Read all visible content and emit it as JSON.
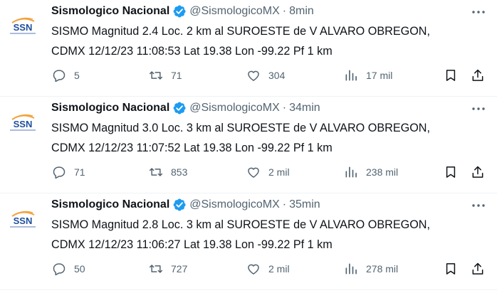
{
  "colors": {
    "text": "#0f1419",
    "muted": "#536471",
    "verified": "#1d9bf0",
    "logo_blue": "#1f4e9c",
    "logo_orange": "#f2a341"
  },
  "icons": {
    "reply": "speech-bubble-icon",
    "retweet": "retweet-arrows-icon",
    "like": "heart-icon",
    "views": "bar-chart-icon",
    "bookmark": "bookmark-icon",
    "share": "share-upload-icon",
    "more": "more-dots-icon",
    "verified": "verified-badge-icon"
  },
  "tweets": [
    {
      "avatar_text": "SSN",
      "name": "Sismologico Nacional",
      "handle": "@SismologicoMX",
      "separator": "·",
      "time": "8min",
      "line1": "SISMO Magnitud 2.4 Loc. 2 km al SUROESTE de V ALVARO OBREGON,",
      "line2": "CDMX 12/12/23 11:08:53 Lat 19.38 Lon -99.22 Pf 1 km",
      "replies": "5",
      "retweets": "71",
      "likes": "304",
      "views": "17 mil"
    },
    {
      "avatar_text": "SSN",
      "name": "Sismologico Nacional",
      "handle": "@SismologicoMX",
      "separator": "·",
      "time": "34min",
      "line1": "SISMO Magnitud 3.0 Loc. 3 km al SUROESTE de V ALVARO OBREGON,",
      "line2": "CDMX 12/12/23 11:07:52 Lat 19.38 Lon -99.22 Pf 1 km",
      "replies": "71",
      "retweets": "853",
      "likes": "2 mil",
      "views": "238 mil"
    },
    {
      "avatar_text": "SSN",
      "name": "Sismologico Nacional",
      "handle": "@SismologicoMX",
      "separator": "·",
      "time": "35min",
      "line1": "SISMO Magnitud 2.8 Loc. 3 km al SUROESTE de V ALVARO OBREGON,",
      "line2": "CDMX 12/12/23 11:06:27 Lat 19.38 Lon -99.22 Pf 1 km",
      "replies": "50",
      "retweets": "727",
      "likes": "2 mil",
      "views": "278 mil"
    }
  ]
}
